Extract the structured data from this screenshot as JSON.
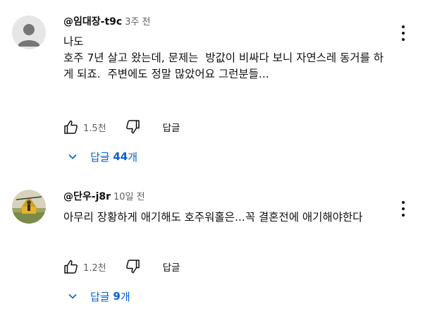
{
  "comments": [
    {
      "handle": "@임대장-t9c",
      "time": "3주 전",
      "text": "나도\n호주 7년 살고 왔는데, 문제는  방값이 비싸다 보니 자연스레 동거를 하게 되죠.  주변에도 정말 많았어요 그런분들...",
      "likes": "1.5천",
      "reply_label": "답글",
      "replies_prefix": "답글 ",
      "replies_count": "44",
      "replies_suffix": "개",
      "avatar": "default-avatar-icon"
    },
    {
      "handle": "@단우-j8r",
      "time": "10일 전",
      "text": "아무리 장황하게 애기해도 호주워홀은...꼭 결혼전에 애기해야한다",
      "likes": "1.2천",
      "reply_label": "답글",
      "replies_prefix": "답글 ",
      "replies_count": "9",
      "replies_suffix": "개",
      "avatar": "photo-avatar-icon"
    }
  ],
  "colors": {
    "text": "#0f0f0f",
    "secondary": "#606060",
    "link": "#065fd4"
  }
}
